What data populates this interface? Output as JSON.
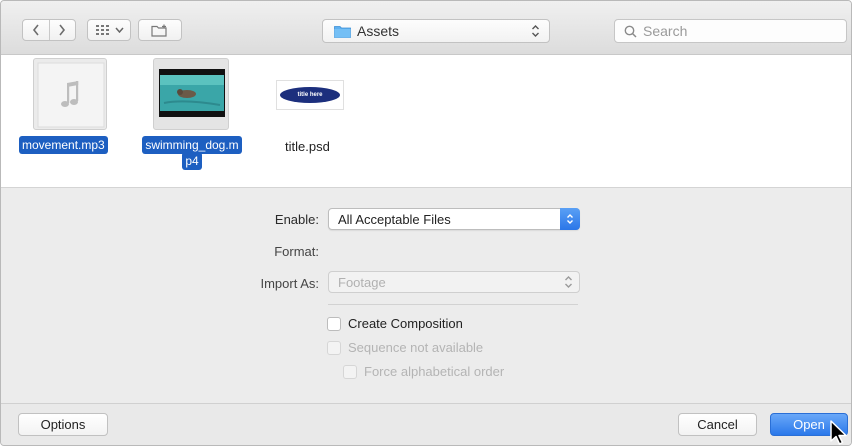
{
  "toolbar": {
    "location_label": "Assets",
    "search_placeholder": "Search"
  },
  "files": [
    {
      "name": "movement.mp3",
      "selected": true,
      "icon": "music-note-icon"
    },
    {
      "name_line1": "swimming_dog.m",
      "name_line2": "p4",
      "selected": true,
      "icon": "video-thumbnail"
    },
    {
      "name": "title.psd",
      "selected": false,
      "icon": "psd-thumbnail",
      "thumb_text": "title here"
    }
  ],
  "options": {
    "enable_label": "Enable:",
    "enable_value": "All Acceptable Files",
    "format_label": "Format:",
    "import_as_label": "Import As:",
    "import_as_value": "Footage",
    "create_composition": "Create Composition",
    "sequence_not_available": "Sequence not available",
    "force_alphabetical": "Force alphabetical order"
  },
  "buttons": {
    "options": "Options",
    "cancel": "Cancel",
    "open": "Open"
  },
  "colors": {
    "accent": "#1d5fc1",
    "primary_button": "#2a78ea"
  }
}
